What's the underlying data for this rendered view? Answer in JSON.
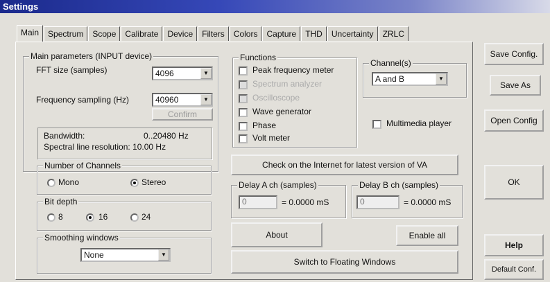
{
  "window": {
    "title": "Settings"
  },
  "tabs": [
    "Main",
    "Spectrum",
    "Scope",
    "Calibrate",
    "Device",
    "Filters",
    "Colors",
    "Capture",
    "THD",
    "Uncertainty",
    "ZRLC"
  ],
  "main_params": {
    "title": "Main parameters (INPUT device)",
    "fft_label": "FFT size (samples)",
    "fft_value": "4096",
    "fs_label": "Frequency sampling (Hz)",
    "fs_value": "40960",
    "confirm_label": "Confirm",
    "bandwidth_label": "Bandwidth:",
    "bandwidth_value": "0..20480 Hz",
    "resolution_label": "Spectral line resolution: 10.00 Hz"
  },
  "channels": {
    "title": "Number of Channels",
    "mono": "Mono",
    "stereo": "Stereo"
  },
  "bitdepth": {
    "title": "Bit depth",
    "opt8": "8",
    "opt16": "16",
    "opt24": "24"
  },
  "smoothing": {
    "title": "Smoothing windows",
    "value": "None"
  },
  "functions": {
    "title": "Functions",
    "items": [
      {
        "label": "Peak frequency meter",
        "enabled": true
      },
      {
        "label": "Spectrum analyzer",
        "enabled": false
      },
      {
        "label": "Oscilloscope",
        "enabled": false
      },
      {
        "label": "Wave generator",
        "enabled": true
      },
      {
        "label": "Phase",
        "enabled": true
      },
      {
        "label": "Volt meter",
        "enabled": true
      }
    ]
  },
  "channel_select": {
    "title": "Channel(s)",
    "value": "A and B"
  },
  "multimedia_label": "Multimedia player",
  "check_internet_label": "Check on the Internet for latest version of VA",
  "delay_a": {
    "title": "Delay A ch (samples)",
    "value": "0",
    "readout": "= 0.0000 mS"
  },
  "delay_b": {
    "title": "Delay B ch (samples)",
    "value": "0",
    "readout": "= 0.0000 mS"
  },
  "about_label": "About",
  "enable_all_label": "Enable all",
  "floating_label": "Switch to Floating Windows",
  "side": {
    "save_config": "Save Config.",
    "save_as": "Save As",
    "open_config": "Open Config",
    "ok": "OK",
    "help": "Help",
    "default_conf": "Default Conf."
  }
}
